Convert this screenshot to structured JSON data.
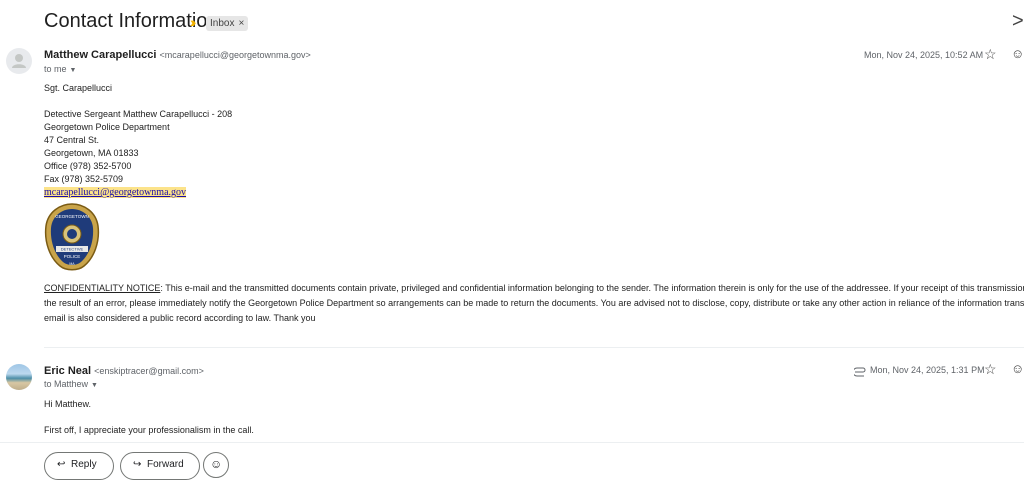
{
  "thread": {
    "subject": "Contact Information",
    "label": "Inbox",
    "label_close": "×",
    "importance_icon": "chevron-importance-icon",
    "close_icon": ">"
  },
  "messages": [
    {
      "sender_name": "Matthew Carapellucci",
      "sender_email": "<mcarapellucci@georgetownma.gov>",
      "to": "to me",
      "date": "Mon, Nov 24, 2025, 10:52 AM",
      "greeting": "Sgt. Carapellucci",
      "signature": [
        "Detective Sergeant Matthew Carapellucci - 208",
        "Georgetown Police Department",
        "47 Central St.",
        "Georgetown, MA 01833",
        "Office (978) 352-5700",
        "Fax (978) 352-5709"
      ],
      "sig_email": "mcarapellucci@georgetownma.gov",
      "badge_text": [
        "GEORGETOWN",
        "DETECTIVE",
        "POLICE",
        "MA"
      ],
      "notice_title": "CONFIDENTIALITY NOTICE",
      "notice_lines": [
        ": This e-mail and the transmitted documents contain private, privileged and confidential information belonging to the sender. The information therein is only for the use of the addressee. If your receipt of this transmission has",
        "the result of an error, please immediately notify the Georgetown Police Department so arrangements can be made to return the documents. You are advised not to disclose, copy, distribute or take any other action in reliance of the information transmitte",
        "email is also considered a public record according to law.  Thank you"
      ]
    },
    {
      "sender_name": "Eric Neal",
      "sender_email": "<enskiptracer@gmail.com>",
      "to": "to Matthew",
      "date": "Mon, Nov 24, 2025, 1:31 PM",
      "attachment_icon": "paperclip-icon",
      "line1": "Hi Matthew.",
      "line2": "First off, I appreciate your professionalism in the call."
    }
  ],
  "actions": {
    "reply": "Reply",
    "forward": "Forward"
  }
}
